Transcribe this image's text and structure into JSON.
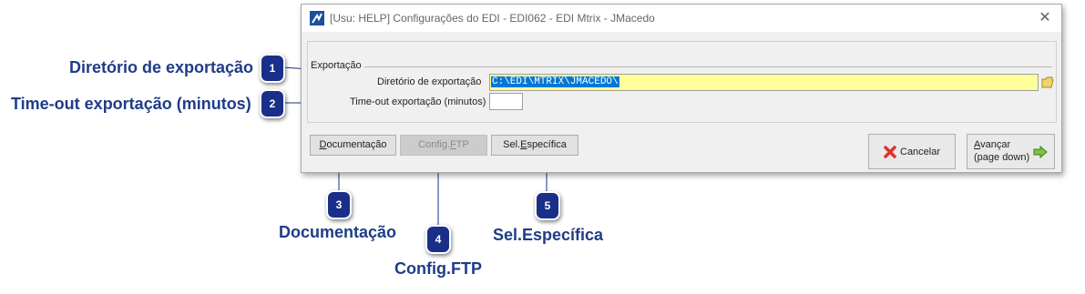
{
  "window": {
    "title": "[Usu: HELP] Configurações do EDI - EDI062 - EDI Mtrix - JMacedo"
  },
  "group": {
    "legend": "Exportação"
  },
  "fields": {
    "dir_label": "Diretório  de exportação",
    "dir_value": "C:\\EDI\\MTRIX\\JMACEDO\\",
    "timeout_label": "Time-out exportação (minutos)",
    "timeout_value": ""
  },
  "buttons": {
    "doc_pre": "",
    "doc_u": "D",
    "doc_post": "ocumentação",
    "ftp_pre": "Config.",
    "ftp_u": "F",
    "ftp_post": "TP",
    "sel_pre": "Sel.",
    "sel_u": "E",
    "sel_post": "specífica",
    "cancel": "Cancelar",
    "next_u": "A",
    "next_post": "vançar",
    "next_line2": "(page down)"
  },
  "callouts": {
    "c1": "Diretório de exportação",
    "c2": "Time-out exportação (minutos)",
    "c3": "Documentação",
    "c4": "Config.FTP",
    "c5": "Sel.Específica"
  },
  "badges": {
    "b1": "1",
    "b2": "2",
    "b3": "3",
    "b4": "4",
    "b5": "5"
  },
  "colors": {
    "callout_text": "#1f3c88",
    "badge": "#1a2f8a",
    "highlight_input": "#ffff99",
    "selection": "#0078d7"
  }
}
